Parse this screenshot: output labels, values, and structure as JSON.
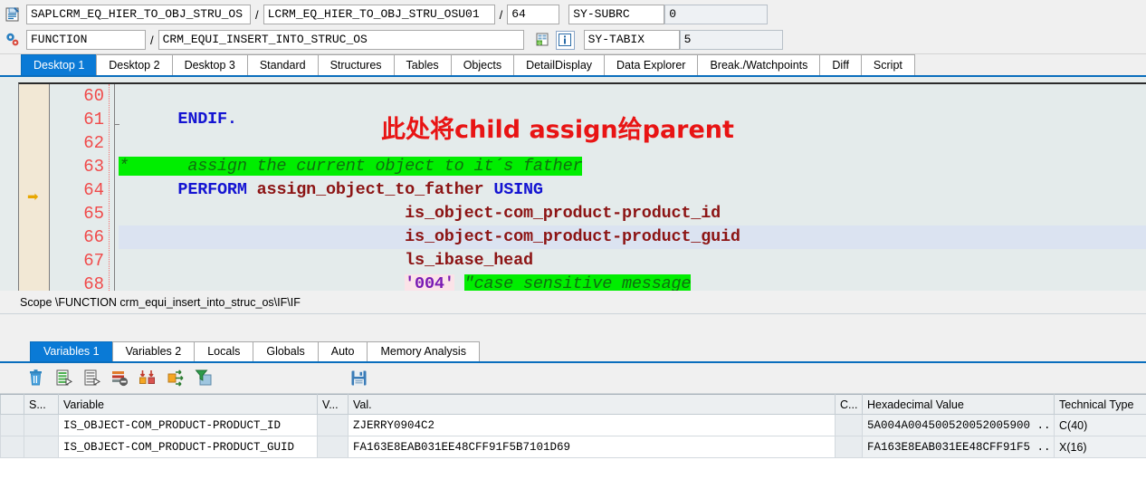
{
  "header": {
    "row1": {
      "icon": "program-edit-icon",
      "program": "SAPLCRM_EQ_HIER_TO_OBJ_STRU_OS",
      "separator1": "/",
      "include": "LCRM_EQ_HIER_TO_OBJ_STRU_OSU01",
      "separator2": "/",
      "line": "64",
      "sys_field_name": "SY-SUBRC",
      "sys_field_value": "0"
    },
    "row2": {
      "icon": "settings-gear-icon",
      "event_kind": "FUNCTION",
      "separator1": "/",
      "event_name": "CRM_EQUI_INSERT_INTO_STRUC_OS",
      "insert_icon": "insert-row-icon",
      "info_icon": "info-icon",
      "sys_field_name": "SY-TABIX",
      "sys_field_value": "5"
    }
  },
  "tabs": {
    "active_index": 0,
    "items": [
      {
        "label": "Desktop 1"
      },
      {
        "label": "Desktop 2"
      },
      {
        "label": "Desktop 3"
      },
      {
        "label": "Standard"
      },
      {
        "label": "Structures"
      },
      {
        "label": "Tables"
      },
      {
        "label": "Objects"
      },
      {
        "label": "DetailDisplay"
      },
      {
        "label": "Data Explorer"
      },
      {
        "label": "Break./Watchpoints"
      },
      {
        "label": "Diff"
      },
      {
        "label": "Script"
      }
    ]
  },
  "editor": {
    "annotation": "此处将child assign给parent",
    "annotation_color": "#e81414",
    "current_line_marker": "exec-arrow-icon",
    "current_line": "64",
    "line_numbers": [
      "60",
      "61",
      "62",
      "63",
      "64",
      "65",
      "66",
      "67",
      "68"
    ],
    "lines": [
      {
        "num": "60",
        "segments": []
      },
      {
        "num": "61",
        "segments": [
          {
            "t": "      ",
            "c": "plain"
          },
          {
            "t": "ENDIF.",
            "c": "kw"
          }
        ]
      },
      {
        "num": "62",
        "segments": []
      },
      {
        "num": "63",
        "segments": [
          {
            "t": "*",
            "c": "star"
          },
          {
            "t": "      assign the current object to it´s father",
            "c": "cmt"
          }
        ]
      },
      {
        "num": "64",
        "segments": [
          {
            "t": "      ",
            "c": "plain"
          },
          {
            "t": "PERFORM",
            "c": "kw"
          },
          {
            "t": " ",
            "c": "plain"
          },
          {
            "t": "assign_object_to_father",
            "c": "idn"
          },
          {
            "t": " ",
            "c": "plain"
          },
          {
            "t": "USING",
            "c": "kw"
          }
        ]
      },
      {
        "num": "65",
        "segments": [
          {
            "t": "                             ",
            "c": "plain"
          },
          {
            "t": "is_object-com_product-product_id",
            "c": "idn"
          }
        ]
      },
      {
        "num": "66",
        "segments": [
          {
            "t": "                             ",
            "c": "plain"
          },
          {
            "t": "is_object-com_product-product_guid",
            "c": "idn"
          }
        ],
        "highlight": true
      },
      {
        "num": "67",
        "segments": [
          {
            "t": "                             ",
            "c": "plain"
          },
          {
            "t": "ls_ibase_head",
            "c": "idn"
          }
        ]
      },
      {
        "num": "68",
        "segments": [
          {
            "t": "                             ",
            "c": "plain"
          },
          {
            "t": "'004'",
            "c": "lit"
          },
          {
            "t": " ",
            "c": "plain"
          },
          {
            "t": "\"case sensitive message",
            "c": "cmt"
          }
        ]
      }
    ]
  },
  "scope": {
    "text": "Scope \\FUNCTION crm_equi_insert_into_struc_os\\IF\\IF"
  },
  "lower_tabs": {
    "active_index": 0,
    "items": [
      {
        "label": "Variables 1"
      },
      {
        "label": "Variables 2"
      },
      {
        "label": "Locals"
      },
      {
        "label": "Globals"
      },
      {
        "label": "Auto"
      },
      {
        "label": "Memory Analysis"
      }
    ]
  },
  "var_toolbar": {
    "buttons": [
      {
        "icon": "delete-trash-icon",
        "title": "Delete"
      },
      {
        "icon": "insert-line-icon",
        "title": "Insert Line"
      },
      {
        "icon": "copy-line-icon",
        "title": "Copy Line"
      },
      {
        "icon": "delete-all-lines-icon",
        "title": "Delete All Lines"
      },
      {
        "icon": "swap-values-icon",
        "title": "Swap Values"
      },
      {
        "icon": "move-icon",
        "title": "Move"
      },
      {
        "icon": "filter-icon",
        "title": "Filter"
      },
      {
        "icon": "save-icon",
        "title": "Save"
      }
    ]
  },
  "var_table": {
    "columns": [
      {
        "label": "",
        "key": "sel"
      },
      {
        "label": "S...",
        "key": "s"
      },
      {
        "label": "Variable",
        "key": "variable"
      },
      {
        "label": "V...",
        "key": "v"
      },
      {
        "label": "Val.",
        "key": "val"
      },
      {
        "label": "C...",
        "key": "c"
      },
      {
        "label": "Hexadecimal Value",
        "key": "hex"
      },
      {
        "label": "Technical Type",
        "key": "tech"
      }
    ],
    "rows": [
      {
        "sel": "",
        "s": "",
        "variable": "IS_OBJECT-COM_PRODUCT-PRODUCT_ID",
        "v": "",
        "val": "ZJERRY0904C2",
        "c": "",
        "hex": "5A004A004500520052005900 ..",
        "tech": "C(40)"
      },
      {
        "sel": "",
        "s": "",
        "variable": "IS_OBJECT-COM_PRODUCT-PRODUCT_GUID",
        "v": "",
        "val": "FA163E8EAB031EE48CFF91F5B7101D69",
        "c": "",
        "hex": "FA163E8EAB031EE48CFF91F5 ..",
        "tech": "X(16)"
      }
    ]
  },
  "colors": {
    "accent": "#0a7ad6",
    "tab_border": "#0a6ebd",
    "comment_highlight": "#00ee00",
    "keyword": "#1414d2",
    "identifier": "#8c1414",
    "line_number": "#f04a4a",
    "annotation": "#e81414",
    "gutter": "#f2e8d5",
    "editor_bg": "#e4ebeb",
    "row_highlight": "#dbe3f1"
  }
}
